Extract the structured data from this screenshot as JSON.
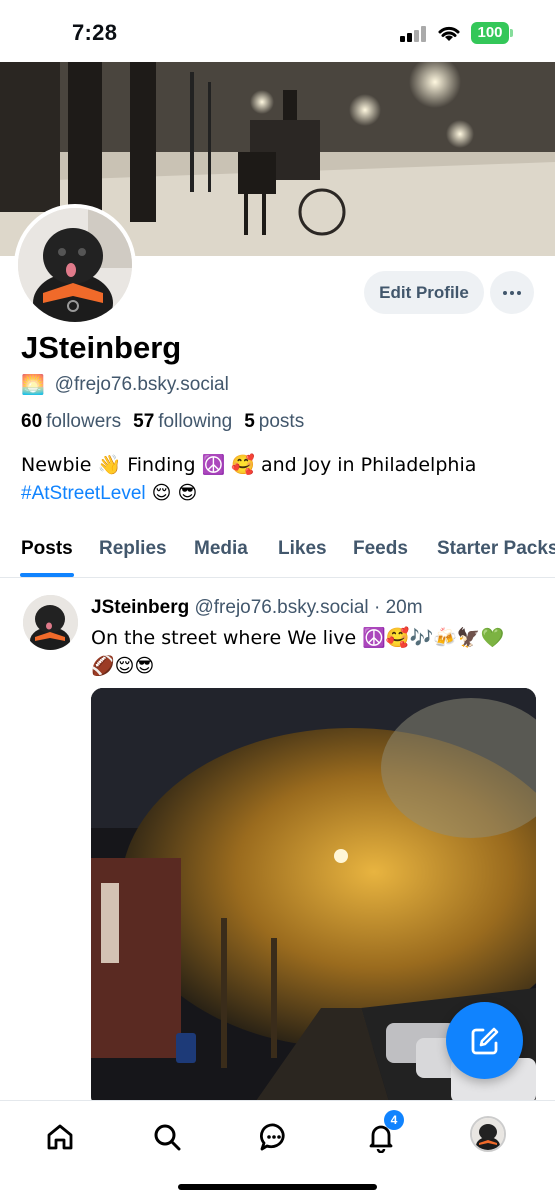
{
  "status": {
    "time": "7:28",
    "battery": "100"
  },
  "profile": {
    "edit_label": "Edit Profile",
    "display_name": "JSteinberg",
    "handle_emoji": "🌅",
    "handle": "@frejo76.bsky.social",
    "followers_count": "60",
    "followers_label": "followers",
    "following_count": "57",
    "following_label": "following",
    "posts_count": "5",
    "posts_label": "posts",
    "bio_line1": "Newbie 👋 Finding ☮️ 🥰 and Joy in Philadelphia",
    "bio_hashtag": "#AtStreetLevel",
    "bio_tail": " 😌 😎"
  },
  "tabs": [
    "Posts",
    "Replies",
    "Media",
    "Likes",
    "Feeds",
    "Starter Packs"
  ],
  "post": {
    "author": "JSteinberg",
    "handle": "@frejo76.bsky.social",
    "separator": " · ",
    "time": "20m",
    "text_line1": "On the street where We live ☮️🥰🎶🍻🦅💚",
    "text_line2": "🏈😌😎"
  },
  "nav": {
    "notifications_badge": "4"
  },
  "colors": {
    "accent": "#1083fe",
    "muted": "#42576c",
    "battery": "#34c759"
  },
  "icons": [
    "home-icon",
    "search-icon",
    "chat-icon",
    "bell-icon",
    "compose-icon",
    "more-icon"
  ]
}
